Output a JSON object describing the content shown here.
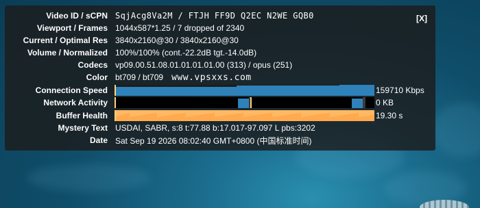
{
  "stats": {
    "close_label": "[X]",
    "rows": [
      {
        "label": "Video ID / sCPN",
        "value": "SqjAcg8Va2M / FTJH FF9D Q2EC N2WE GQB0"
      },
      {
        "label": "Viewport / Frames",
        "value": "1044x587*1.25 / 7 dropped of 2340"
      },
      {
        "label": "Current / Optimal Res",
        "value": "3840x2160@30 / 3840x2160@30"
      },
      {
        "label": "Volume / Normalized",
        "value": "100%/100% (cont.-22.2dB tgt.-14.0dB)"
      },
      {
        "label": "Codecs",
        "value": "vp09.00.51.08.01.01.01.01.00 (313) / opus (251)"
      },
      {
        "label": "Color",
        "value": "bt709 / bt709"
      },
      {
        "label": "Connection Speed",
        "value": "159710 Kbps"
      },
      {
        "label": "Network Activity",
        "value": "0 KB"
      },
      {
        "label": "Buffer Health",
        "value": "19.30 s"
      },
      {
        "label": "Mystery Text",
        "value": "USDAI, SABR, s:8 t:77.88 b:17.017-97.097 L pbs:3202"
      },
      {
        "label": "Date",
        "value": "Sat Sep 19 2026 08:02:40 GMT+0800 (中国标准时间)"
      }
    ],
    "watermark": "www.vpsxxs.com"
  },
  "colors": {
    "panel_bg": "rgba(28,28,28,0.82)",
    "graph_blue": "#2e82b9",
    "graph_orange": "#ffb865",
    "graph_yellow": "#ffd27a"
  }
}
